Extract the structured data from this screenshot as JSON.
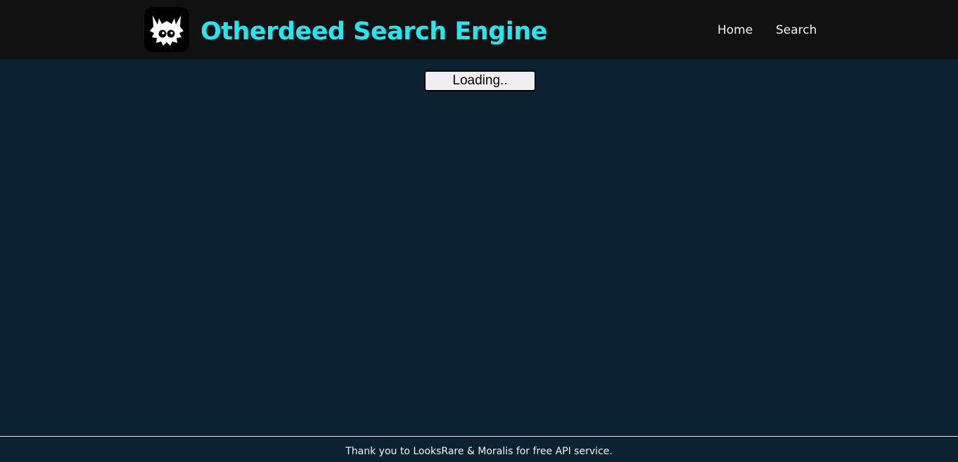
{
  "header": {
    "logo_icon": "otherdeed-koda-icon",
    "title": "Otherdeed Search Engine",
    "nav": [
      {
        "label": "Home"
      },
      {
        "label": "Search"
      }
    ]
  },
  "main": {
    "loading_button_label": "Loading.."
  },
  "footer": {
    "text": "Thank you to LooksRare & Moralis for free API service."
  },
  "colors": {
    "header_bg": "#111111",
    "page_bg": "#0b2233",
    "title_accent": "#1ee8f0",
    "nav_text": "#f2f2f2"
  }
}
